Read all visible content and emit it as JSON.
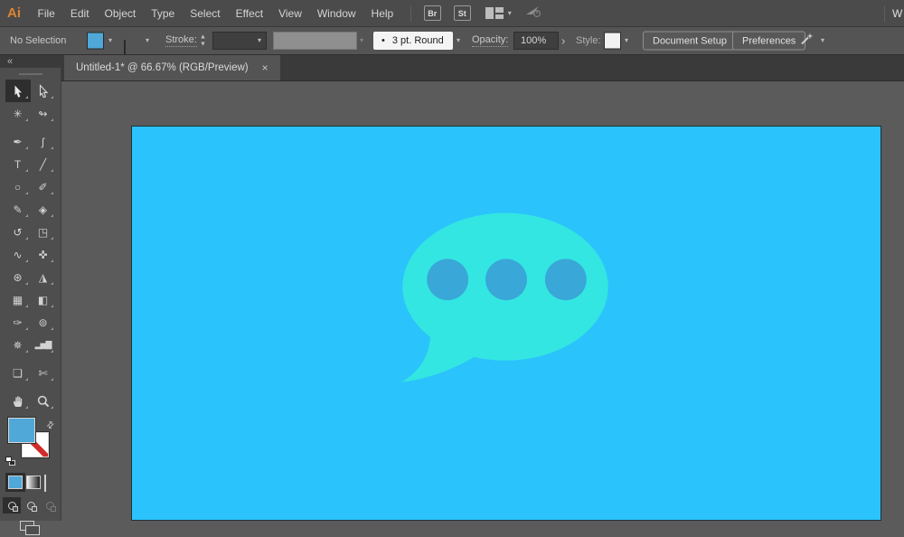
{
  "app": {
    "logo": "Ai",
    "workspace_clipped": "W"
  },
  "menubar": {
    "items": [
      "File",
      "Edit",
      "Object",
      "Type",
      "Select",
      "Effect",
      "View",
      "Window",
      "Help"
    ],
    "bridge_button": "Br",
    "style_button": "St"
  },
  "controlbar": {
    "selection_status": "No Selection",
    "stroke_label": "Stroke:",
    "brush_dot": "•",
    "brush_definition": "3 pt. Round",
    "opacity_label": "Opacity:",
    "opacity_value": "100%",
    "opacity_more": "›",
    "style_label": "Style:",
    "document_setup_button": "Document Setup",
    "preferences_button": "Preferences"
  },
  "tabbar": {
    "collapse_glyph": "«",
    "title": "Untitled-1* @ 66.67% (RGB/Preview)",
    "close_glyph": "×"
  },
  "toolbar": {
    "tools": [
      {
        "name": "selection-tool",
        "active": true
      },
      {
        "name": "direct-selection-tool"
      },
      {
        "name": "magic-wand-tool",
        "glyph": "✳"
      },
      {
        "name": "lasso-tool",
        "glyph": "↬"
      },
      {
        "name": "pen-tool",
        "glyph": "✒"
      },
      {
        "name": "curvature-tool",
        "glyph": "ʃ"
      },
      {
        "name": "type-tool",
        "glyph": "T"
      },
      {
        "name": "line-segment-tool",
        "glyph": "╱"
      },
      {
        "name": "ellipse-tool",
        "glyph": "○"
      },
      {
        "name": "paintbrush-tool",
        "glyph": "✐"
      },
      {
        "name": "shaper-tool",
        "glyph": "✎"
      },
      {
        "name": "eraser-tool",
        "glyph": "◈"
      },
      {
        "name": "rotate-tool",
        "glyph": "↺"
      },
      {
        "name": "scale-tool",
        "glyph": "◳"
      },
      {
        "name": "width-tool",
        "glyph": "∿"
      },
      {
        "name": "puppet-warp-tool",
        "glyph": "✜"
      },
      {
        "name": "shape-builder-tool",
        "glyph": "⊛"
      },
      {
        "name": "perspective-grid-tool",
        "glyph": "◮"
      },
      {
        "name": "mesh-tool",
        "glyph": "▦"
      },
      {
        "name": "gradient-tool",
        "glyph": "◧"
      },
      {
        "name": "eyedropper-tool",
        "glyph": "✑"
      },
      {
        "name": "blend-tool",
        "glyph": "⊚"
      },
      {
        "name": "symbol-sprayer-tool",
        "glyph": "✵"
      },
      {
        "name": "column-graph-tool",
        "glyph": "▂▅▇"
      },
      {
        "name": "artboard-tool",
        "glyph": "❏"
      },
      {
        "name": "slice-tool",
        "glyph": "✄"
      },
      {
        "name": "hand-tool"
      },
      {
        "name": "zoom-tool"
      }
    ],
    "swap_glyph": "⇄"
  },
  "swatches": {
    "fill": "#4FA8D8",
    "none_red": "#D22B2B"
  },
  "canvas": {
    "artboard": "#2AC3FC",
    "bubble": "#33E6E2",
    "dot": "#39A7D7"
  }
}
